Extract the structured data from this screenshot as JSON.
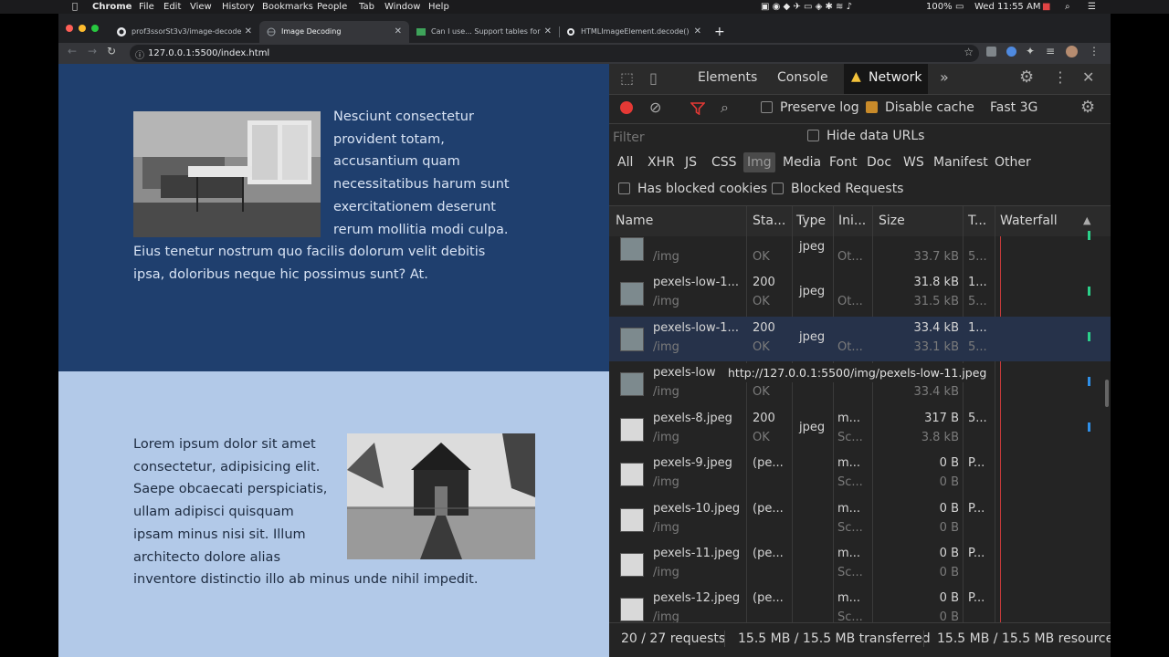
{
  "menubar": {
    "apple_icon": "apple-icon",
    "app": "Chrome",
    "items": [
      "File",
      "Edit",
      "View",
      "History",
      "Bookmarks",
      "People",
      "Tab",
      "Window",
      "Help"
    ],
    "battery": "100%",
    "clock": "Wed 11:55 AM"
  },
  "tabs": [
    {
      "label": "prof3ssorSt3v3/image-decode",
      "icon": "github-icon"
    },
    {
      "label": "Image Decoding",
      "icon": "globe-icon"
    },
    {
      "label": "Can I use... Support tables for",
      "icon": "caniuse-icon"
    },
    {
      "label": "HTMLImageElement.decode()",
      "icon": "mdn-icon"
    }
  ],
  "new_tab": "+",
  "address": {
    "url": "127.0.0.1:5500/index.html"
  },
  "page": {
    "para1": "Nesciunt consectetur provident totam, accusantium quam necessitatibus harum sunt exercitationem deserunt rerum mollitia modi culpa. Eius tenetur nostrum quo facilis dolorum velit debitis ipsa, doloribus neque hic possimus sunt? At.",
    "para2": "Lorem ipsum dolor sit amet consectetur, adipisicing elit. Saepe obcaecati perspiciatis, ullam adipisci quisquam ipsam minus nisi sit. Illum architecto dolore alias inventore distinctio illo ab minus unde nihil impedit."
  },
  "devtools": {
    "tabs": [
      "Elements",
      "Console",
      "Network"
    ],
    "active_tab": "Network",
    "more": "»",
    "preserve_log": "Preserve log",
    "disable_cache": "Disable cache",
    "throttle": "Fast 3G",
    "filter_placeholder": "Filter",
    "hide_data_urls": "Hide data URLs",
    "types": [
      "All",
      "XHR",
      "JS",
      "CSS",
      "Img",
      "Media",
      "Font",
      "Doc",
      "WS",
      "Manifest",
      "Other"
    ],
    "active_type": "Img",
    "has_blocked_cookies": "Has blocked cookies",
    "blocked_requests": "Blocked Requests",
    "columns": [
      "Name",
      "Sta...",
      "Type",
      "Ini...",
      "Size",
      "T...",
      "Waterfall"
    ],
    "sort_indicator": "▲",
    "rows": [
      {
        "name": "",
        "path": "/img",
        "status": "",
        "status2": "OK",
        "type": "jpeg",
        "init": "",
        "init2": "Ot...",
        "size": "",
        "size2": "33.7 kB",
        "time": "",
        "time2": "5...",
        "broken": false
      },
      {
        "name": "pexels-low-1...",
        "path": "/img",
        "status": "200",
        "status2": "OK",
        "type": "jpeg",
        "init": "",
        "init2": "Ot...",
        "size": "31.8 kB",
        "size2": "31.5 kB",
        "time": "1...",
        "time2": "5...",
        "broken": false
      },
      {
        "name": "pexels-low-1...",
        "path": "/img",
        "status": "200",
        "status2": "OK",
        "type": "jpeg",
        "init": "",
        "init2": "Ot...",
        "size": "33.4 kB",
        "size2": "33.1 kB",
        "time": "1...",
        "time2": "5...",
        "broken": false
      },
      {
        "name": "pexels-low",
        "path": "/img",
        "status": "",
        "status2": "OK",
        "type": "",
        "init": "",
        "init2": "",
        "size": "",
        "size2": "33.4 kB",
        "time": "",
        "time2": "",
        "broken": false
      },
      {
        "name": "pexels-8.jpeg",
        "path": "/img",
        "status": "200",
        "status2": "OK",
        "type": "jpeg",
        "init": "m...",
        "init2": "Sc...",
        "size": "317 B",
        "size2": "3.8 kB",
        "time": "5...",
        "time2": "",
        "broken": true
      },
      {
        "name": "pexels-9.jpeg",
        "path": "/img",
        "status": "(pe...",
        "status2": "",
        "type": "",
        "init": "m...",
        "init2": "Sc...",
        "size": "0 B",
        "size2": "0 B",
        "time": "P...",
        "time2": "",
        "broken": true
      },
      {
        "name": "pexels-10.jpeg",
        "path": "/img",
        "status": "(pe...",
        "status2": "",
        "type": "",
        "init": "m...",
        "init2": "Sc...",
        "size": "0 B",
        "size2": "0 B",
        "time": "P...",
        "time2": "",
        "broken": true
      },
      {
        "name": "pexels-11.jpeg",
        "path": "/img",
        "status": "(pe...",
        "status2": "",
        "type": "",
        "init": "m...",
        "init2": "Sc...",
        "size": "0 B",
        "size2": "0 B",
        "time": "P...",
        "time2": "",
        "broken": true
      },
      {
        "name": "pexels-12.jpeg",
        "path": "/img",
        "status": "(pe...",
        "status2": "",
        "type": "",
        "init": "m...",
        "init2": "Sc...",
        "size": "0 B",
        "size2": "0 B",
        "time": "P...",
        "time2": "",
        "broken": true
      }
    ],
    "tooltip": "http://127.0.0.1:5500/img/pexels-low-11.jpeg",
    "status_requests": "20 / 27 requests",
    "status_transferred": "15.5 MB / 15.5 MB transferred",
    "status_resources": "15.5 MB / 15.5 MB resource"
  },
  "colors": {
    "record": "#e53935",
    "filter_active": "#e53935",
    "warning": "#f3c23a",
    "waterfall_blue": "#2f8fe8",
    "waterfall_green": "#2bd08a"
  }
}
